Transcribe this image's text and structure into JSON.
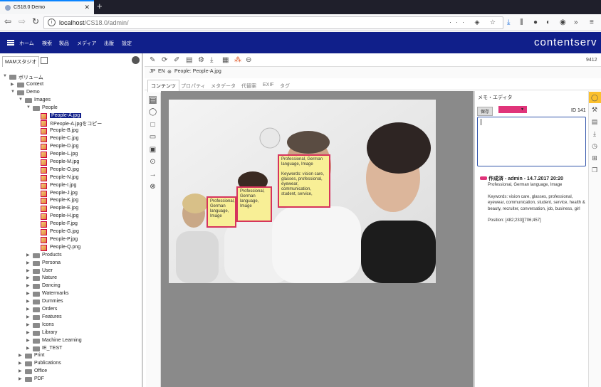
{
  "browser": {
    "tab_title": "CS18.0 Demo",
    "tab_close": "✕",
    "new_tab": "+",
    "url_host": "localhost",
    "url_path": "/CS18.0/admin/",
    "url_menu": "···"
  },
  "app": {
    "brand": "contentserv",
    "menu": [
      "ホーム",
      "検索",
      "製品",
      "メディア",
      "出版",
      "設定"
    ]
  },
  "left_panel": {
    "tab_label": "MAMスタジオ",
    "tree": [
      {
        "label": "ボリューム",
        "level": 0,
        "type": "root",
        "expanded": true
      },
      {
        "label": "Context",
        "level": 1,
        "type": "folder"
      },
      {
        "label": "Demo",
        "level": 1,
        "type": "folder",
        "expanded": true
      },
      {
        "label": "Images",
        "level": 2,
        "type": "folder",
        "expanded": true
      },
      {
        "label": "People",
        "level": 3,
        "type": "folder",
        "expanded": true
      },
      {
        "label": "People-A.jpg",
        "level": 4,
        "type": "file",
        "selected": true
      },
      {
        "label": "®People-A.jpgをコピー",
        "level": 4,
        "type": "file"
      },
      {
        "label": "People-B.jpg",
        "level": 4,
        "type": "file"
      },
      {
        "label": "People-C.jpg",
        "level": 4,
        "type": "file"
      },
      {
        "label": "People-D.jpg",
        "level": 4,
        "type": "file"
      },
      {
        "label": "People-L.jpg",
        "level": 4,
        "type": "file"
      },
      {
        "label": "People-M.jpg",
        "level": 4,
        "type": "file"
      },
      {
        "label": "People-O.jpg",
        "level": 4,
        "type": "file"
      },
      {
        "label": "People-N.jpg",
        "level": 4,
        "type": "file"
      },
      {
        "label": "People-I.jpg",
        "level": 4,
        "type": "file"
      },
      {
        "label": "People-J.jpg",
        "level": 4,
        "type": "file"
      },
      {
        "label": "People-K.jpg",
        "level": 4,
        "type": "file"
      },
      {
        "label": "People-E.jpg",
        "level": 4,
        "type": "file"
      },
      {
        "label": "People-H.jpg",
        "level": 4,
        "type": "file"
      },
      {
        "label": "People-F.jpg",
        "level": 4,
        "type": "file"
      },
      {
        "label": "People-G.jpg",
        "level": 4,
        "type": "file"
      },
      {
        "label": "People-P.jpg",
        "level": 4,
        "type": "file"
      },
      {
        "label": "People-Q.png",
        "level": 4,
        "type": "file"
      },
      {
        "label": "Products",
        "level": 3,
        "type": "folder"
      },
      {
        "label": "Persona",
        "level": 3,
        "type": "folder"
      },
      {
        "label": "User",
        "level": 3,
        "type": "folder"
      },
      {
        "label": "Nature",
        "level": 3,
        "type": "folder"
      },
      {
        "label": "Dancing",
        "level": 3,
        "type": "folder"
      },
      {
        "label": "Watermarks",
        "level": 3,
        "type": "folder"
      },
      {
        "label": "Dummies",
        "level": 3,
        "type": "folder"
      },
      {
        "label": "Orders",
        "level": 3,
        "type": "folder"
      },
      {
        "label": "Features",
        "level": 3,
        "type": "folder"
      },
      {
        "label": "Icons",
        "level": 3,
        "type": "folder"
      },
      {
        "label": "Library",
        "level": 3,
        "type": "folder"
      },
      {
        "label": "Machine Learning",
        "level": 3,
        "type": "folder"
      },
      {
        "label": "IE_TEST",
        "level": 3,
        "type": "folder"
      },
      {
        "label": "Print",
        "level": 2,
        "type": "folder"
      },
      {
        "label": "Publications",
        "level": 2,
        "type": "folder"
      },
      {
        "label": "Office",
        "level": 2,
        "type": "folder"
      },
      {
        "label": "PDF",
        "level": 2,
        "type": "folder"
      }
    ]
  },
  "main": {
    "count": "9412",
    "breadcrumb": {
      "lang1": "JP",
      "lang2": "EN",
      "path": "People: People-A.jpg"
    },
    "tabs": [
      "コンテンツ",
      "プロパティ",
      "メタデータ",
      "代替案",
      "EXIF",
      "タグ"
    ],
    "notes": [
      {
        "text": "Professional, German language, Image"
      },
      {
        "text": "Professional, German language, Image"
      },
      {
        "text": "Professional, German language, Image\n\nKeywords: vision care, glasses, professional, eyewear, communication, student, service,"
      }
    ]
  },
  "right_panel": {
    "title": "メモ・エディタ",
    "save_label": "保存",
    "status_label": "作成済",
    "id_label": "ID 141",
    "entry": {
      "header": "作成済 - admin - 14.7.2017 20:20",
      "subtitle": "Professional, German language, Image",
      "keywords": "Keywords: vision care, glasses, professional, eyewear, communication, student, service, health & beauty, recruiter, conversation, job, business, girl",
      "position": "Position: [482;233][706;457]"
    }
  },
  "colors": {
    "brand_bar": "#101f8a",
    "note_border": "#d6345c",
    "note_fill": "#f8ef96",
    "status": "#e0347a",
    "active_strip": "#fbc02d"
  }
}
